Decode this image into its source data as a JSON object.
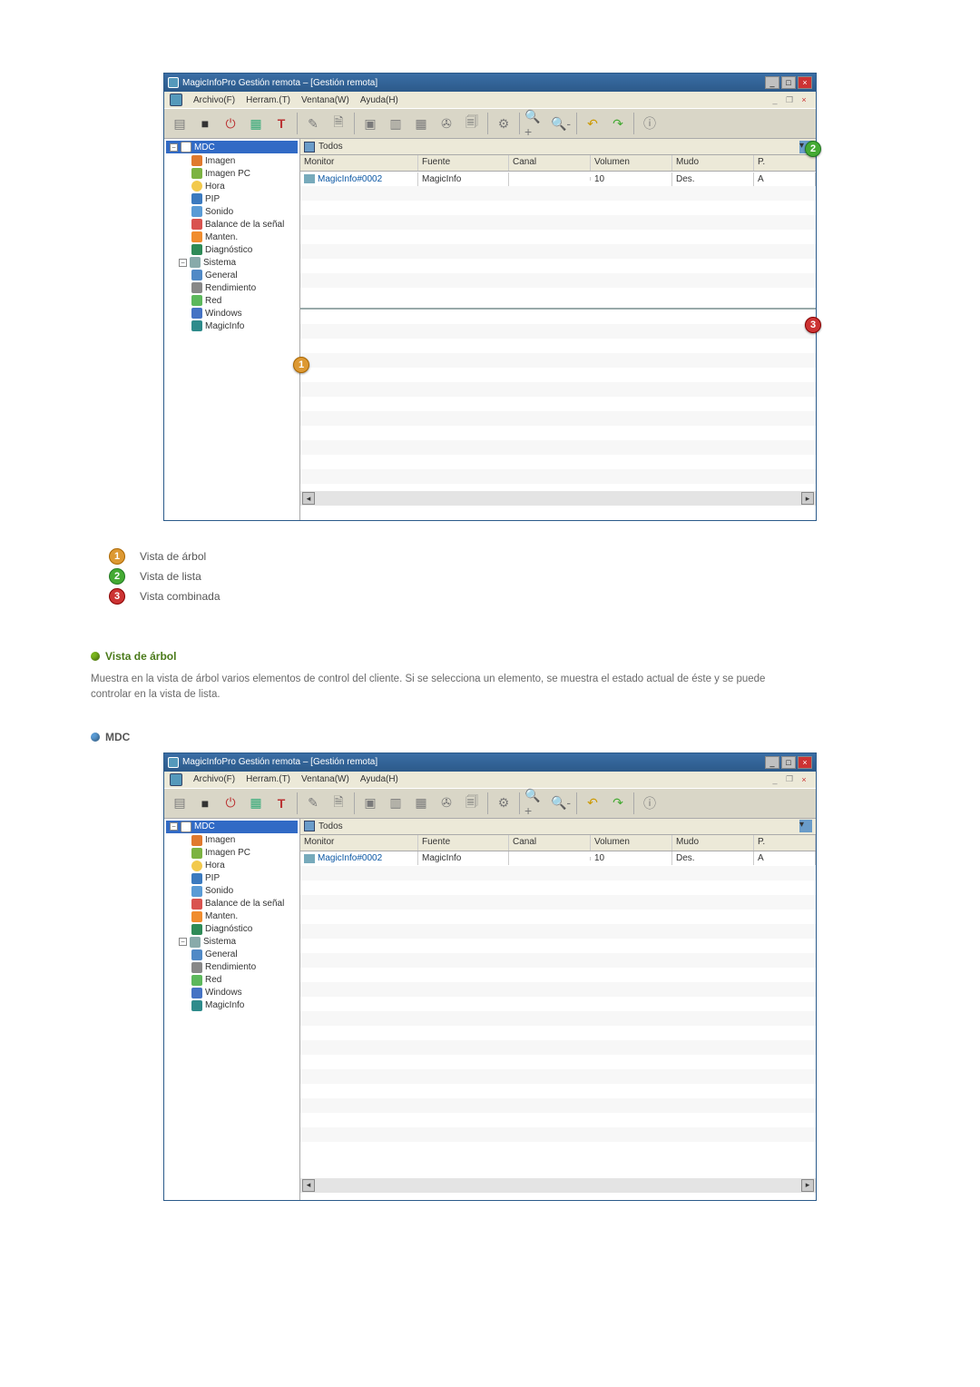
{
  "window": {
    "title": "MagicInfoPro Gestión remota – [Gestión remota]",
    "min_label": "_",
    "max_label": "□",
    "close_label": "×"
  },
  "menu": {
    "archivo": "Archivo(F)",
    "herram": "Herram.(T)",
    "ventana": "Ventana(W)",
    "ayuda": "Ayuda(H)"
  },
  "tree": {
    "root": "MDC",
    "items": [
      {
        "label": "Imagen",
        "icon": "ic-imagen"
      },
      {
        "label": "Imagen PC",
        "icon": "ic-imagenpc"
      },
      {
        "label": "Hora",
        "icon": "ic-hora"
      },
      {
        "label": "PIP",
        "icon": "ic-pip"
      },
      {
        "label": "Sonido",
        "icon": "ic-sonido"
      },
      {
        "label": "Balance de la señal",
        "icon": "ic-balance"
      },
      {
        "label": "Manten.",
        "icon": "ic-manten"
      },
      {
        "label": "Diagnóstico",
        "icon": "ic-diag"
      }
    ],
    "sistema_label": "Sistema",
    "sistema_items": [
      {
        "label": "General",
        "icon": "ic-general"
      },
      {
        "label": "Rendimiento",
        "icon": "ic-rendim"
      },
      {
        "label": "Red",
        "icon": "ic-red"
      },
      {
        "label": "Windows",
        "icon": "ic-windows"
      },
      {
        "label": "MagicInfo",
        "icon": "ic-magicinfo"
      }
    ]
  },
  "list": {
    "group_label": "Todos",
    "columns": {
      "monitor": "Monitor",
      "fuente": "Fuente",
      "canal": "Canal",
      "volumen": "Volumen",
      "mudo": "Mudo",
      "extra": "P."
    },
    "rows": [
      {
        "monitor": "MagicInfo#0002",
        "fuente": "MagicInfo",
        "canal": "",
        "volumen": "10",
        "mudo": "Des.",
        "extra": "A"
      }
    ]
  },
  "callouts": {
    "c1": "1",
    "c2": "2",
    "c3": "3"
  },
  "legend": {
    "l1": "Vista de árbol",
    "l2": "Vista de lista",
    "l3": "Vista combinada"
  },
  "section_tree": {
    "title": "Vista de árbol",
    "text": "Muestra en la vista de árbol varios elementos de control del cliente. Si se selecciona un elemento, se muestra el estado actual de éste y se puede controlar en la vista de lista."
  },
  "section_mdc": {
    "title": "MDC"
  }
}
